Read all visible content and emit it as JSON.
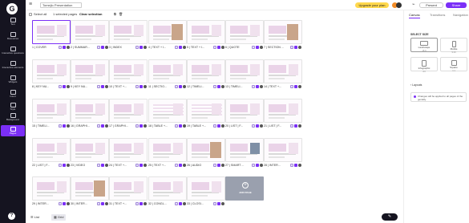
{
  "app": {
    "logo": "G"
  },
  "sidebar": {
    "items": [
      {
        "label": "Text",
        "icon": "text-icon"
      },
      {
        "label": "Resources",
        "icon": "resources-icon"
      },
      {
        "label": "Interactive questions",
        "icon": "question-icon"
      },
      {
        "label": "Interactive elements",
        "icon": "interactive-icon"
      },
      {
        "label": "Widgets",
        "icon": "widgets-icon"
      },
      {
        "label": "Insert",
        "icon": "insert-icon"
      },
      {
        "label": "Style",
        "icon": "style-icon"
      },
      {
        "label": "Background",
        "icon": "background-icon"
      },
      {
        "label": "Pages",
        "icon": "pages-icon",
        "active": true
      }
    ],
    "help": "?"
  },
  "topbar": {
    "menu": "≡",
    "title": "Tomejlo Presentation",
    "upgrade": "Upgrade your plan",
    "present": "Present",
    "share": "Share"
  },
  "selection": {
    "select_all": "Select all",
    "count": "1 selected pages",
    "clear": "Clear selection"
  },
  "slides": [
    {
      "label": "1 | COVER",
      "variant": "plain",
      "selected": true
    },
    {
      "label": "2 | SUMMAR...",
      "variant": "plain"
    },
    {
      "label": "3 | INDEX",
      "variant": "plain"
    },
    {
      "label": "4 | TEXT + I...",
      "variant": "photo"
    },
    {
      "label": "5 | TEXT + I...",
      "variant": "plain"
    },
    {
      "label": "6 | QUOTE",
      "variant": "plain"
    },
    {
      "label": "7 | SECTION ...",
      "variant": "photo"
    },
    {
      "label": "8 | KEY NU...",
      "variant": "plain"
    },
    {
      "label": "9 | KEY NU...",
      "variant": "plain"
    },
    {
      "label": "10 | TEXT +...",
      "variant": "plain"
    },
    {
      "label": "11 | SECTIO...",
      "variant": "plain"
    },
    {
      "label": "12 | TIMELI...",
      "variant": "plain"
    },
    {
      "label": "13 | TIMELI...",
      "variant": "plain"
    },
    {
      "label": "14 | TEXT +...",
      "variant": "plain"
    },
    {
      "label": "15 | TIMELI...",
      "variant": "plain"
    },
    {
      "label": "16 | GRAPHI...",
      "variant": "plain"
    },
    {
      "label": "17 | GRAPHI...",
      "variant": "plain"
    },
    {
      "label": "18 | TABLE +...",
      "variant": "table"
    },
    {
      "label": "19 | TABLE +...",
      "variant": "table"
    },
    {
      "label": "20 | LIST | F...",
      "variant": "plain"
    },
    {
      "label": "21 | LIST | F...",
      "variant": "plain"
    },
    {
      "label": "22 | LIST | F...",
      "variant": "plain"
    },
    {
      "label": "23 | VIDEO",
      "variant": "plain"
    },
    {
      "label": "24 | TEXT +...",
      "variant": "plain"
    },
    {
      "label": "25 | TEXT +...",
      "variant": "plain"
    },
    {
      "label": "26 | AUDIO",
      "variant": "photo"
    },
    {
      "label": "27 | SMART ...",
      "variant": "dark"
    },
    {
      "label": "28 | INTER...",
      "variant": "plain"
    },
    {
      "label": "29 | INTER...",
      "variant": "plain"
    },
    {
      "label": "30 | INTER...",
      "variant": "photo"
    },
    {
      "label": "31 | TEXT +...",
      "variant": "plain"
    },
    {
      "label": "32 | CONGL...",
      "variant": "plain"
    },
    {
      "label": "33 | CLOSI...",
      "variant": "plain"
    }
  ],
  "add_page": {
    "label": "ADD PAGE",
    "plus": "+"
  },
  "panel": {
    "tabs": [
      "Canvas",
      "Transitions",
      "Navigation"
    ],
    "active_tab": 0,
    "select_size_label": "SELECT SIZE",
    "sizes": [
      {
        "name": "Landscape",
        "ratio": "16:9",
        "active": true
      },
      {
        "name": "Mobile",
        "ratio": "9:16"
      },
      {
        "name": "Infographic",
        "ratio": "A4"
      },
      {
        "name": "Square",
        "ratio": "1:1"
      }
    ],
    "layouts_label": "Layouts",
    "note": "Changes will be applied to all pages of the genially."
  },
  "bottom": {
    "list_label": "List",
    "grid_label": "Grid",
    "edit_icon": "✎"
  },
  "colors": {
    "accent": "#7b2ff7",
    "sidebar": "#151420",
    "upgrade": "#ffd84d"
  }
}
